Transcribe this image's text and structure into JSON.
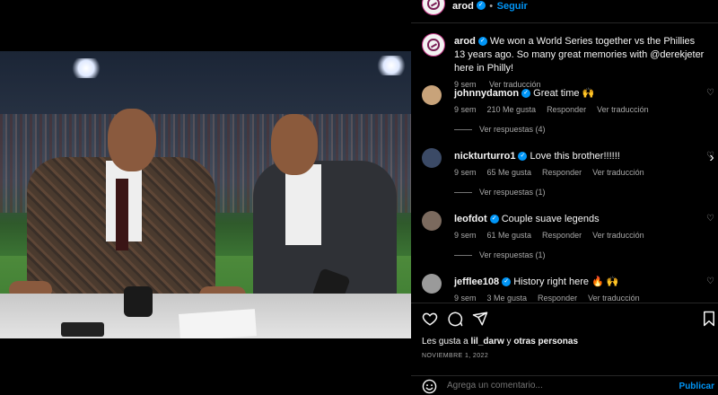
{
  "post": {
    "username": "arod",
    "follow_label": "Seguir",
    "dot": "•",
    "caption": "We won a World Series together vs the Phillies 13 years ago. So many great memories with @derekjeter here in Philly!",
    "caption_time": "9 sem",
    "see_translation": "Ver traducción",
    "likes_prefix": "Les gusta a",
    "likes_user": "lil_darw",
    "likes_and": "y",
    "likes_others": "otras personas",
    "date": "NOVIEMBRE 1, 2022",
    "add_comment_placeholder": "Agrega un comentario...",
    "publish_label": "Publicar"
  },
  "comments": [
    {
      "user": "johnnydamon",
      "text": "Great time 🙌",
      "time": "9 sem",
      "likes": "210 Me gusta",
      "reply": "Responder",
      "translate": "Ver traducción",
      "replies": "Ver respuestas (4)"
    },
    {
      "user": "nickturturro1",
      "text": "Love this brother!!!!!!",
      "time": "9 sem",
      "likes": "65 Me gusta",
      "reply": "Responder",
      "translate": "Ver traducción",
      "replies": "Ver respuestas (1)"
    },
    {
      "user": "leofdot",
      "text": "Couple suave legends",
      "time": "9 sem",
      "likes": "61 Me gusta",
      "reply": "Responder",
      "translate": "Ver traducción",
      "replies": "Ver respuestas (1)"
    },
    {
      "user": "jefflee108",
      "text": "History right here 🔥 🙌",
      "time": "9 sem",
      "likes": "3 Me gusta",
      "reply": "Responder",
      "translate": "Ver traducción",
      "replies": ""
    }
  ],
  "icons": {
    "like": "heart-icon",
    "comment": "comment-icon",
    "share": "share-icon",
    "save": "bookmark-icon",
    "emoji": "emoji-icon",
    "next": "chevron-right-icon",
    "verified": "verified-badge-icon"
  },
  "colors": {
    "accent": "#0095f6",
    "background": "#000000",
    "muted": "#a8a8a8"
  }
}
